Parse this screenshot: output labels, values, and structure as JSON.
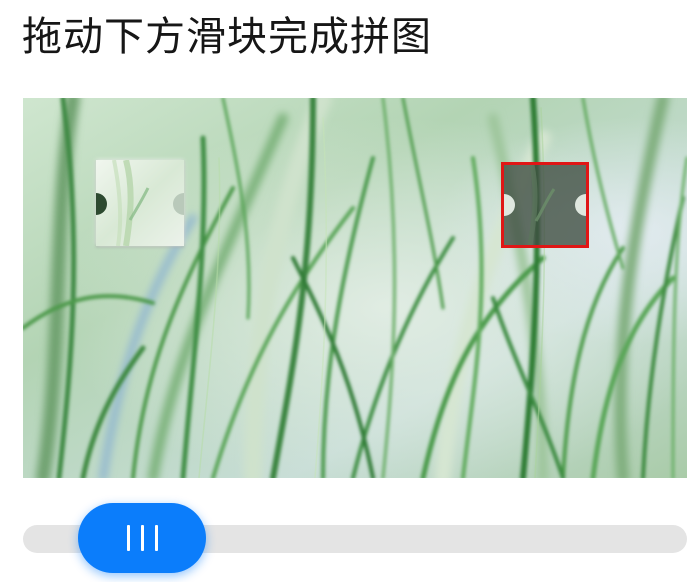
{
  "header": {
    "title": "拖动下方滑块完成拼图"
  },
  "captcha": {
    "image_description_icon": "grass-background-image",
    "puzzle_piece_icon": "puzzle-piece-icon",
    "target_slot_icon": "puzzle-slot-icon",
    "target_border_color": "#e01616"
  },
  "slider": {
    "handle_icon": "drag-grip-icon",
    "accent_color": "#0b7dfb",
    "track_color": "#e4e4e4"
  }
}
